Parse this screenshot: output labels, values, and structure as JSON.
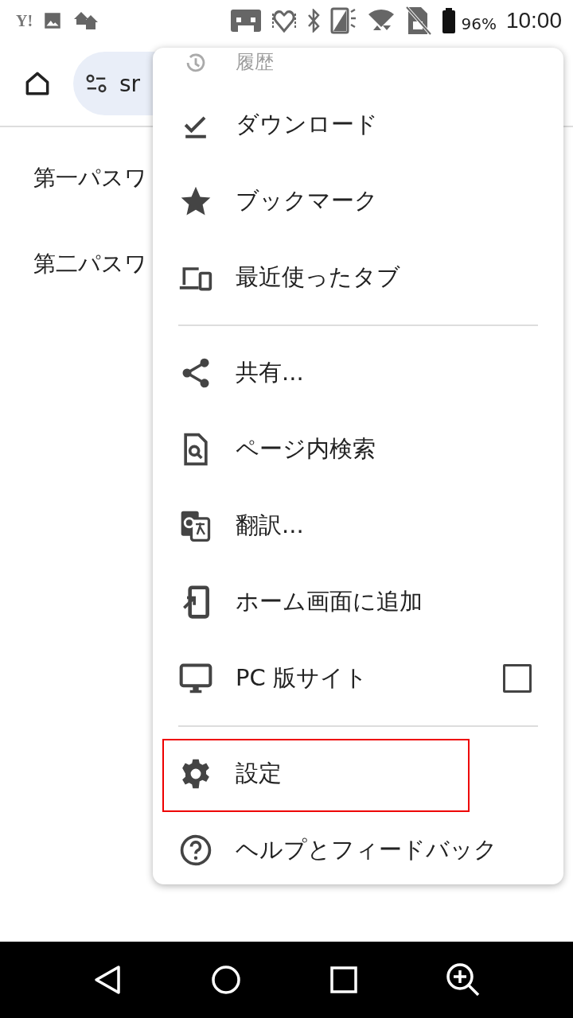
{
  "status_bar": {
    "left_logo": "Y!",
    "battery": "96%",
    "time": "10:00"
  },
  "toolbar": {
    "address": "sr"
  },
  "page": {
    "lines": [
      "第一パスワ",
      "第二パスワ"
    ]
  },
  "menu": {
    "items": [
      {
        "kind": "item",
        "label": "履歴",
        "faded": true,
        "highlighted": false
      },
      {
        "kind": "item",
        "label": "ダウンロード",
        "faded": false,
        "highlighted": false
      },
      {
        "kind": "item",
        "label": "ブックマーク",
        "faded": false,
        "highlighted": false
      },
      {
        "kind": "item",
        "label": "最近使ったタブ",
        "faded": false,
        "highlighted": false
      },
      {
        "kind": "divider"
      },
      {
        "kind": "item",
        "label": "共有...",
        "faded": false,
        "highlighted": false
      },
      {
        "kind": "item",
        "label": "ページ内検索",
        "faded": false,
        "highlighted": false
      },
      {
        "kind": "item",
        "label": "翻訳...",
        "faded": false,
        "highlighted": false
      },
      {
        "kind": "item",
        "label": "ホーム画面に追加",
        "faded": false,
        "highlighted": false
      },
      {
        "kind": "checkbox",
        "label": "PC 版サイト",
        "checked": false,
        "faded": false,
        "highlighted": false
      },
      {
        "kind": "divider"
      },
      {
        "kind": "item",
        "label": "設定",
        "faded": false,
        "highlighted": true
      },
      {
        "kind": "item",
        "label": "ヘルプとフィードバック",
        "faded": false,
        "highlighted": false
      }
    ]
  }
}
